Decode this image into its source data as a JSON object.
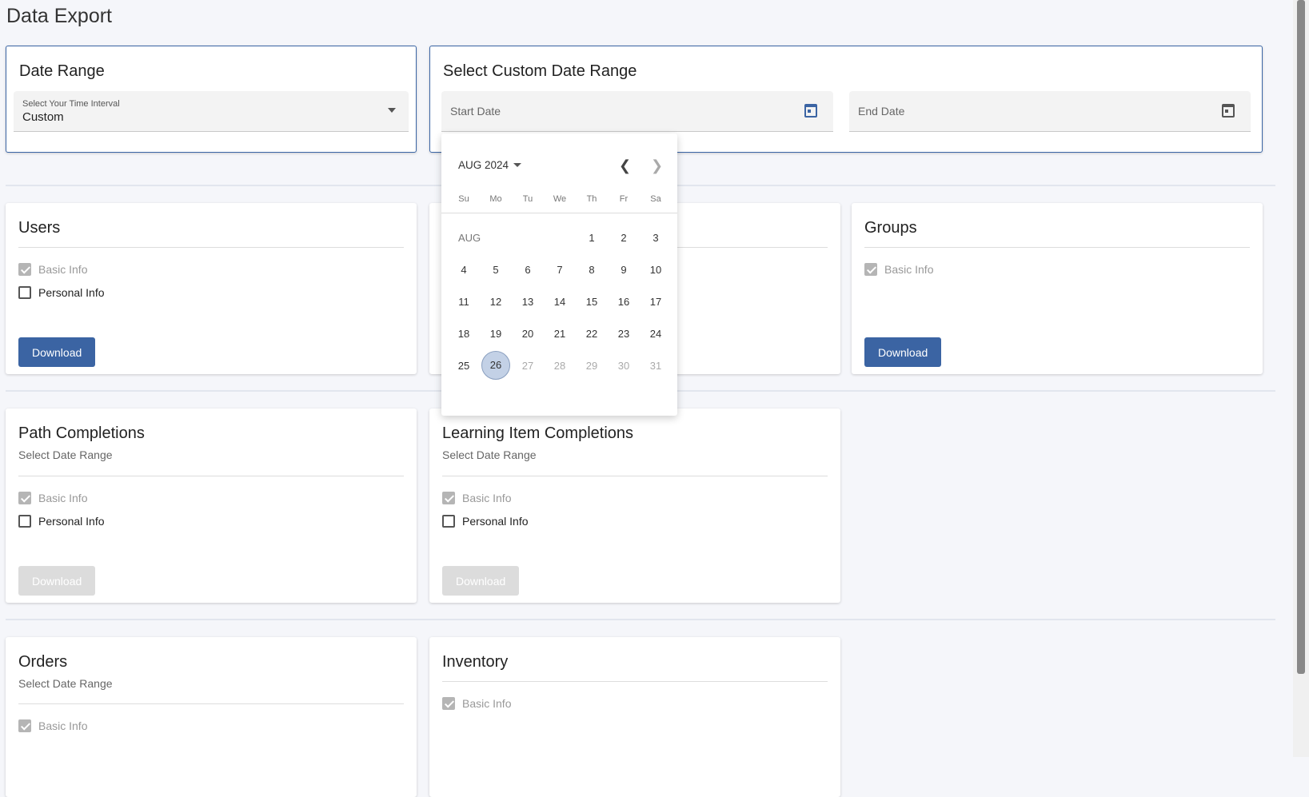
{
  "page": {
    "title": "Data Export"
  },
  "date_range": {
    "title": "Date Range",
    "select_label": "Select Your Time Interval",
    "select_value": "Custom"
  },
  "custom_range": {
    "title": "Select Custom Date Range",
    "start_placeholder": "Start Date",
    "end_placeholder": "End Date",
    "accent": "#3b64a3"
  },
  "calendar": {
    "month_label": "AUG 2024",
    "weekdays": [
      "Su",
      "Mo",
      "Tu",
      "We",
      "Th",
      "Fr",
      "Sa"
    ],
    "month_short": "AUG",
    "weeks": [
      [
        "",
        "",
        "",
        "",
        "1",
        "2",
        "3"
      ],
      [
        "4",
        "5",
        "6",
        "7",
        "8",
        "9",
        "10"
      ],
      [
        "11",
        "12",
        "13",
        "14",
        "15",
        "16",
        "17"
      ],
      [
        "18",
        "19",
        "20",
        "21",
        "22",
        "23",
        "24"
      ],
      [
        "25",
        "26",
        "27",
        "28",
        "29",
        "30",
        "31"
      ]
    ],
    "selected": "26",
    "disabled_after": "26"
  },
  "cards": {
    "users": {
      "title": "Users",
      "basic": "Basic Info",
      "personal": "Personal Info",
      "download": "Download"
    },
    "groups": {
      "title": "Groups",
      "basic": "Basic Info",
      "download": "Download"
    },
    "path": {
      "title": "Path Completions",
      "subtitle": "Select Date Range",
      "basic": "Basic Info",
      "personal": "Personal Info",
      "download": "Download"
    },
    "learning": {
      "title": "Learning Item Completions",
      "subtitle": "Select Date Range",
      "basic": "Basic Info",
      "personal": "Personal Info",
      "download": "Download"
    },
    "orders": {
      "title": "Orders",
      "subtitle": "Select Date Range",
      "basic": "Basic Info"
    },
    "inventory": {
      "title": "Inventory",
      "basic": "Basic Info"
    }
  }
}
